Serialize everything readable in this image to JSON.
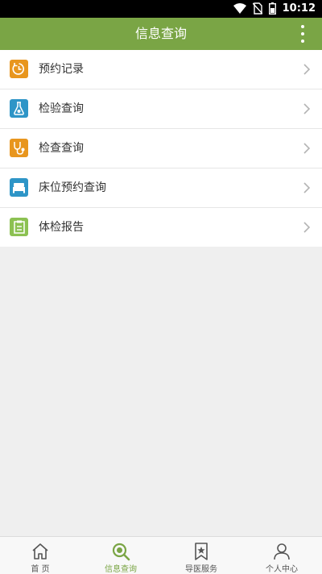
{
  "status_bar": {
    "time": "10:12"
  },
  "header": {
    "title": "信息查询"
  },
  "menu": [
    {
      "label": "预约记录",
      "icon": "clock-icon",
      "color": "#e8961e"
    },
    {
      "label": "检验查询",
      "icon": "flask-icon",
      "color": "#2e95c7"
    },
    {
      "label": "检查查询",
      "icon": "stethoscope-icon",
      "color": "#e8961e"
    },
    {
      "label": "床位预约查询",
      "icon": "bed-icon",
      "color": "#2e95c7"
    },
    {
      "label": "体检报告",
      "icon": "report-icon",
      "color": "#8cc152"
    }
  ],
  "tabs": [
    {
      "label": "首 页",
      "icon": "home-icon",
      "active": false
    },
    {
      "label": "信息查询",
      "icon": "search-icon",
      "active": true
    },
    {
      "label": "导医服务",
      "icon": "bookmark-star-icon",
      "active": false
    },
    {
      "label": "个人中心",
      "icon": "person-icon",
      "active": false
    }
  ],
  "colors": {
    "accent": "#7aa545",
    "background": "#efefef"
  }
}
